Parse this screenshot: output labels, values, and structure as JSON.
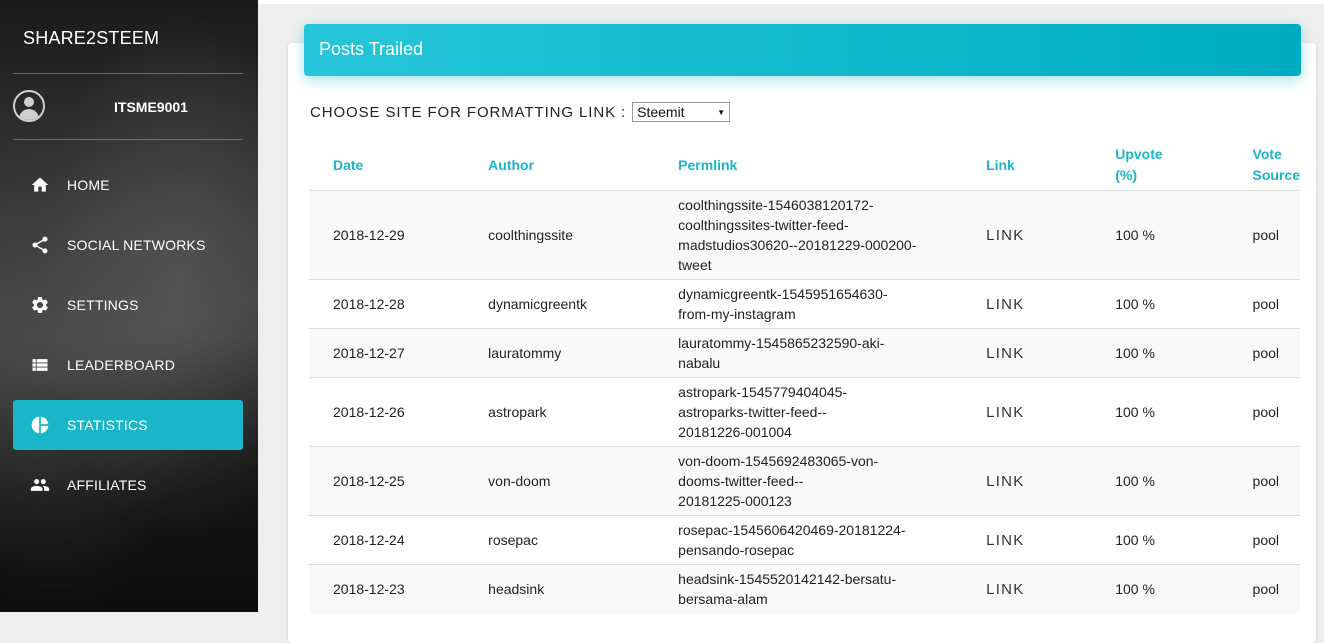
{
  "sidebar": {
    "brand": "SHARE2STEEM",
    "username": "ITSME9001",
    "items": [
      {
        "label": "HOME",
        "icon": "home-icon"
      },
      {
        "label": "SOCIAL NETWORKS",
        "icon": "share-icon"
      },
      {
        "label": "SETTINGS",
        "icon": "gear-icon"
      },
      {
        "label": "LEADERBOARD",
        "icon": "list-icon"
      },
      {
        "label": "STATISTICS",
        "icon": "pie-chart-icon",
        "active": true
      },
      {
        "label": "AFFILIATES",
        "icon": "people-icon"
      }
    ]
  },
  "card": {
    "title": "Posts Trailed",
    "choose_label": "CHOOSE SITE FOR FORMATTING LINK :",
    "select_value": "Steemit"
  },
  "table": {
    "headers": {
      "date": "Date",
      "author": "Author",
      "permlink": "Permlink",
      "link": "Link",
      "upvote_line1": "Upvote",
      "upvote_line2": "(%)",
      "source_line1": "Vote",
      "source_line2": "Source"
    },
    "rows": [
      {
        "date": "2018-12-29",
        "author": "coolthingssite",
        "permlink": [
          "coolthingssite-1546038120172-",
          "coolthingssites-twitter-feed-",
          "madstudios30620--20181229-000200-",
          "tweet"
        ],
        "link": "LINK",
        "upvote": "100 %",
        "source": "pool"
      },
      {
        "date": "2018-12-28",
        "author": "dynamicgreentk",
        "permlink": [
          "dynamicgreentk-1545951654630-",
          "from-my-instagram"
        ],
        "link": "LINK",
        "upvote": "100 %",
        "source": "pool"
      },
      {
        "date": "2018-12-27",
        "author": "lauratommy",
        "permlink": [
          "lauratommy-1545865232590-aki-",
          "nabalu"
        ],
        "link": "LINK",
        "upvote": "100 %",
        "source": "pool"
      },
      {
        "date": "2018-12-26",
        "author": "astropark",
        "permlink": [
          "astropark-1545779404045-",
          "astroparks-twitter-feed--",
          "20181226-001004"
        ],
        "link": "LINK",
        "upvote": "100 %",
        "source": "pool"
      },
      {
        "date": "2018-12-25",
        "author": "von-doom",
        "permlink": [
          "von-doom-1545692483065-von-",
          "dooms-twitter-feed--",
          "20181225-000123"
        ],
        "link": "LINK",
        "upvote": "100 %",
        "source": "pool"
      },
      {
        "date": "2018-12-24",
        "author": "rosepac",
        "permlink": [
          "rosepac-1545606420469-20181224-",
          "pensando-rosepac"
        ],
        "link": "LINK",
        "upvote": "100 %",
        "source": "pool"
      },
      {
        "date": "2018-12-23",
        "author": "headsink",
        "permlink": [
          "headsink-1545520142142-bersatu-",
          "bersama-alam"
        ],
        "link": "LINK",
        "upvote": "100 %",
        "source": "pool"
      }
    ]
  }
}
